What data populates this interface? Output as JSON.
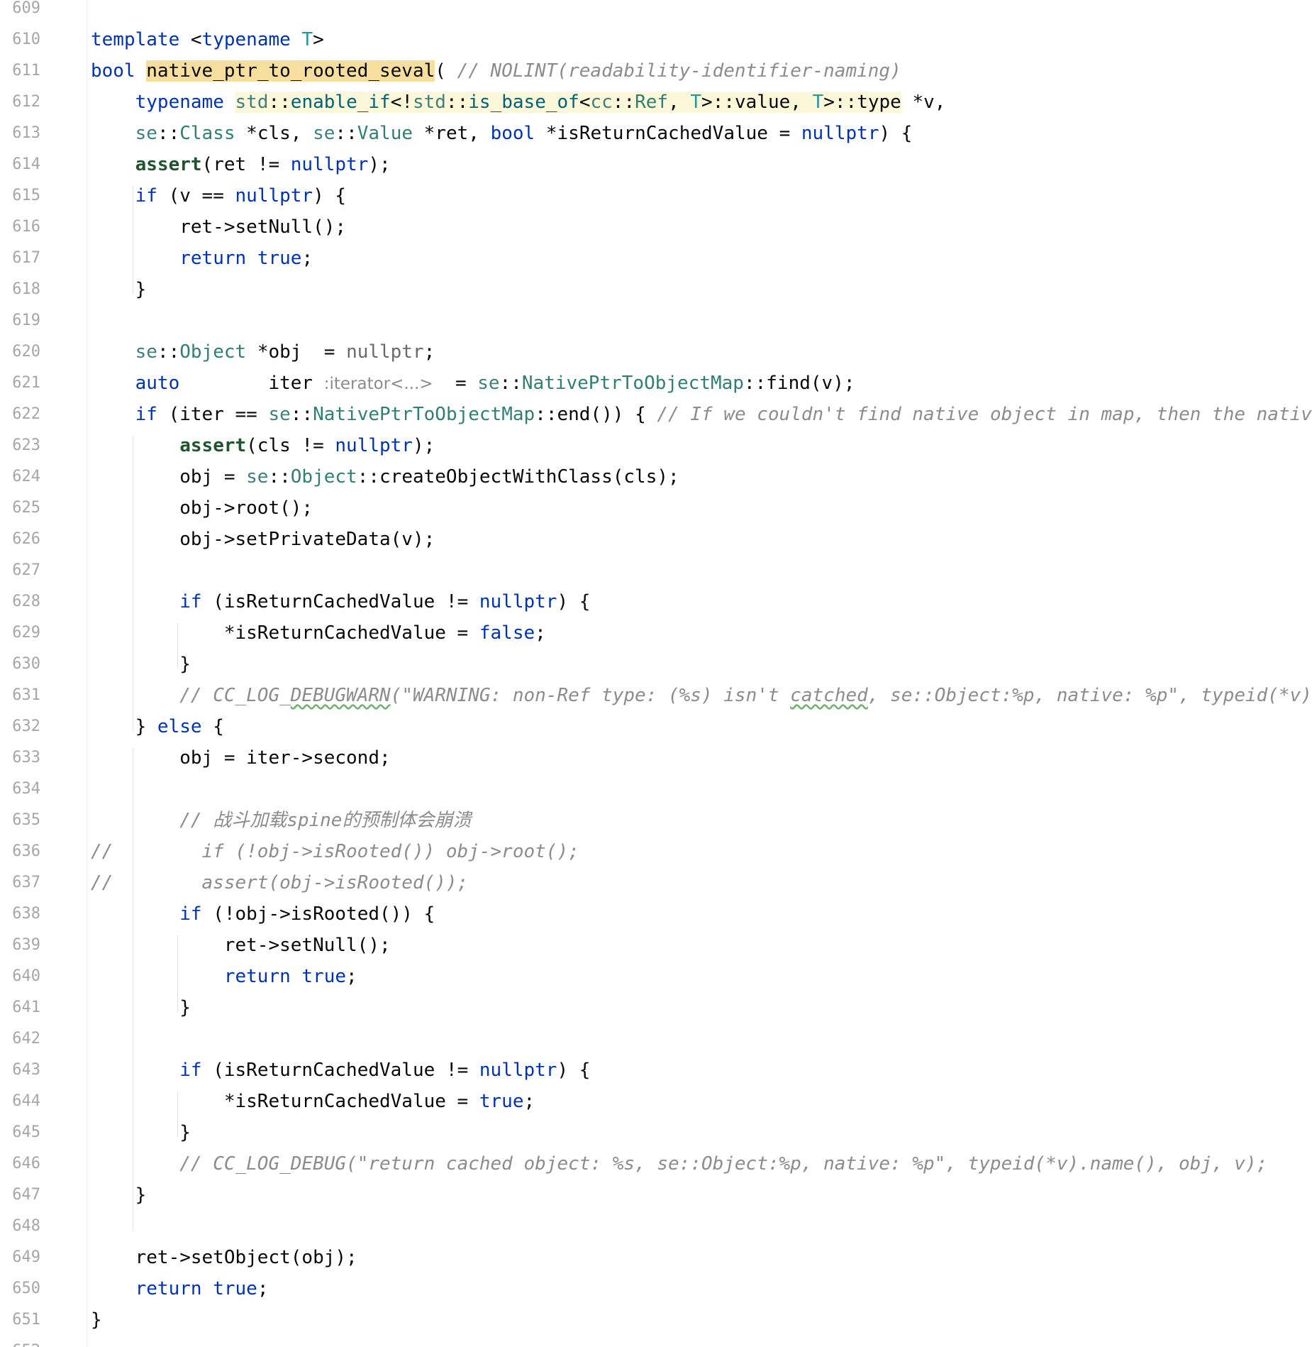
{
  "editor": {
    "first_line_number": 609,
    "lines": [
      [],
      [
        {
          "t": "template",
          "c": "kw"
        },
        {
          "t": " <"
        },
        {
          "t": "typename",
          "c": "kw"
        },
        {
          "t": " "
        },
        {
          "t": "T",
          "c": "tp"
        },
        {
          "t": ">"
        }
      ],
      [
        {
          "t": "bool",
          "c": "kw"
        },
        {
          "t": " "
        },
        {
          "t": "native_ptr_to_rooted_seval",
          "c": "hl-name"
        },
        {
          "t": "( "
        },
        {
          "t": "// NOLINT(readability-identifier-naming)",
          "c": "cm"
        }
      ],
      [
        {
          "t": "    "
        },
        {
          "t": "typename",
          "c": "kw"
        },
        {
          "t": " "
        },
        {
          "t": "std",
          "c": "ns hl-type"
        },
        {
          "t": "::",
          "c": "hl-type"
        },
        {
          "t": "enable_if",
          "c": "fn hl-type"
        },
        {
          "t": "<!",
          "c": "hl-type"
        },
        {
          "t": "std",
          "c": "ns hl-type"
        },
        {
          "t": "::",
          "c": "hl-type"
        },
        {
          "t": "is_base_of",
          "c": "fn hl-type"
        },
        {
          "t": "<",
          "c": "hl-type"
        },
        {
          "t": "cc",
          "c": "ns hl-type"
        },
        {
          "t": "::",
          "c": "hl-type"
        },
        {
          "t": "Ref",
          "c": "ty hl-type"
        },
        {
          "t": ", ",
          "c": "hl-type"
        },
        {
          "t": "T",
          "c": "tp hl-type"
        },
        {
          "t": ">::value, ",
          "c": "hl-type"
        },
        {
          "t": "T",
          "c": "tp hl-type"
        },
        {
          "t": ">::type",
          "c": "hl-type"
        },
        {
          "t": " *v,"
        }
      ],
      [
        {
          "t": "    "
        },
        {
          "t": "se",
          "c": "ns"
        },
        {
          "t": "::"
        },
        {
          "t": "Class",
          "c": "ty"
        },
        {
          "t": " *cls, "
        },
        {
          "t": "se",
          "c": "ns"
        },
        {
          "t": "::"
        },
        {
          "t": "Value",
          "c": "ty"
        },
        {
          "t": " *ret, "
        },
        {
          "t": "bool",
          "c": "kw"
        },
        {
          "t": " *isReturnCachedValue = "
        },
        {
          "t": "nullptr",
          "c": "kw"
        },
        {
          "t": ") {"
        }
      ],
      [
        {
          "t": "    "
        },
        {
          "t": "assert",
          "c": "mac"
        },
        {
          "t": "(ret != "
        },
        {
          "t": "nullptr",
          "c": "kw"
        },
        {
          "t": ");"
        }
      ],
      [
        {
          "t": "    "
        },
        {
          "t": "if",
          "c": "kw"
        },
        {
          "t": " (v == "
        },
        {
          "t": "nullptr",
          "c": "kw"
        },
        {
          "t": ") {"
        }
      ],
      [
        {
          "t": "        ret->setNull();"
        }
      ],
      [
        {
          "t": "        "
        },
        {
          "t": "return",
          "c": "kw"
        },
        {
          "t": " "
        },
        {
          "t": "true",
          "c": "kw"
        },
        {
          "t": ";"
        }
      ],
      [
        {
          "t": "    }"
        }
      ],
      [],
      [
        {
          "t": "    "
        },
        {
          "t": "se",
          "c": "ns"
        },
        {
          "t": "::"
        },
        {
          "t": "Object",
          "c": "ty"
        },
        {
          "t": " *obj  = "
        },
        {
          "t": "nullptr",
          "c": "cm-plain"
        },
        {
          "t": ";"
        }
      ],
      [
        {
          "t": "    "
        },
        {
          "t": "auto",
          "c": "kw"
        },
        {
          "t": "        iter "
        },
        {
          "t": ":iterator<...>",
          "c": "hint"
        },
        {
          "t": "  = "
        },
        {
          "t": "se",
          "c": "ns"
        },
        {
          "t": "::"
        },
        {
          "t": "NativePtrToObjectMap",
          "c": "ty"
        },
        {
          "t": "::find(v);"
        }
      ],
      [
        {
          "t": "    "
        },
        {
          "t": "if",
          "c": "kw"
        },
        {
          "t": " (iter == "
        },
        {
          "t": "se",
          "c": "ns"
        },
        {
          "t": "::"
        },
        {
          "t": "NativePtrToObjectMap",
          "c": "ty"
        },
        {
          "t": "::end()) { "
        },
        {
          "t": "// If we couldn't find native object in map, then the native",
          "c": "cm"
        }
      ],
      [
        {
          "t": "        "
        },
        {
          "t": "assert",
          "c": "mac"
        },
        {
          "t": "(cls != "
        },
        {
          "t": "nullptr",
          "c": "kw"
        },
        {
          "t": ");"
        }
      ],
      [
        {
          "t": "        obj = "
        },
        {
          "t": "se",
          "c": "ns"
        },
        {
          "t": "::"
        },
        {
          "t": "Object",
          "c": "ty"
        },
        {
          "t": "::createObjectWithClass(cls);"
        }
      ],
      [
        {
          "t": "        obj->root();"
        }
      ],
      [
        {
          "t": "        obj->setPrivateData(v);"
        }
      ],
      [],
      [
        {
          "t": "        "
        },
        {
          "t": "if",
          "c": "kw"
        },
        {
          "t": " (isReturnCachedValue != "
        },
        {
          "t": "nullptr",
          "c": "kw"
        },
        {
          "t": ") {"
        }
      ],
      [
        {
          "t": "            *isReturnCachedValue = "
        },
        {
          "t": "false",
          "c": "kw"
        },
        {
          "t": ";"
        }
      ],
      [
        {
          "t": "        }"
        }
      ],
      [
        {
          "t": "        "
        },
        {
          "t": "// CC_LOG_",
          "c": "cm"
        },
        {
          "t": "DEBUGWARN",
          "c": "cm squiggle"
        },
        {
          "t": "(\"WARNING: non-Ref type: (%s) isn't ",
          "c": "cm"
        },
        {
          "t": "catched",
          "c": "cm squiggle"
        },
        {
          "t": ", se::Object:%p, native: %p\", typeid(*v).",
          "c": "cm"
        }
      ],
      [
        {
          "t": "    } "
        },
        {
          "t": "else",
          "c": "kw"
        },
        {
          "t": " {"
        }
      ],
      [
        {
          "t": "        obj = iter->second;"
        }
      ],
      [],
      [
        {
          "t": "        "
        },
        {
          "t": "// 战斗加载spine的预制体会崩溃",
          "c": "cm"
        }
      ],
      [
        {
          "t": "//        if (!obj->isRooted()) obj->root();",
          "c": "cm"
        }
      ],
      [
        {
          "t": "//        assert(obj->isRooted());",
          "c": "cm"
        }
      ],
      [
        {
          "t": "        "
        },
        {
          "t": "if",
          "c": "kw"
        },
        {
          "t": " (!obj->isRooted()) {"
        }
      ],
      [
        {
          "t": "            ret->setNull();"
        }
      ],
      [
        {
          "t": "            "
        },
        {
          "t": "return",
          "c": "kw"
        },
        {
          "t": " "
        },
        {
          "t": "true",
          "c": "kw"
        },
        {
          "t": ";"
        }
      ],
      [
        {
          "t": "        }"
        }
      ],
      [],
      [
        {
          "t": "        "
        },
        {
          "t": "if",
          "c": "kw"
        },
        {
          "t": " (isReturnCachedValue != "
        },
        {
          "t": "nullptr",
          "c": "kw"
        },
        {
          "t": ") {"
        }
      ],
      [
        {
          "t": "            *isReturnCachedValue = "
        },
        {
          "t": "true",
          "c": "kw"
        },
        {
          "t": ";"
        }
      ],
      [
        {
          "t": "        }"
        }
      ],
      [
        {
          "t": "        "
        },
        {
          "t": "// CC_LOG_DEBUG(\"return cached object: %s, se::Object:%p, native: %p\", typeid(*v).name(), obj, v);",
          "c": "cm"
        }
      ],
      [
        {
          "t": "    }"
        }
      ],
      [],
      [
        {
          "t": "    ret->setObject(obj);"
        }
      ],
      [
        {
          "t": "    "
        },
        {
          "t": "return",
          "c": "kw"
        },
        {
          "t": " "
        },
        {
          "t": "true",
          "c": "kw"
        },
        {
          "t": ";"
        }
      ],
      [
        {
          "t": "}"
        }
      ],
      []
    ]
  }
}
